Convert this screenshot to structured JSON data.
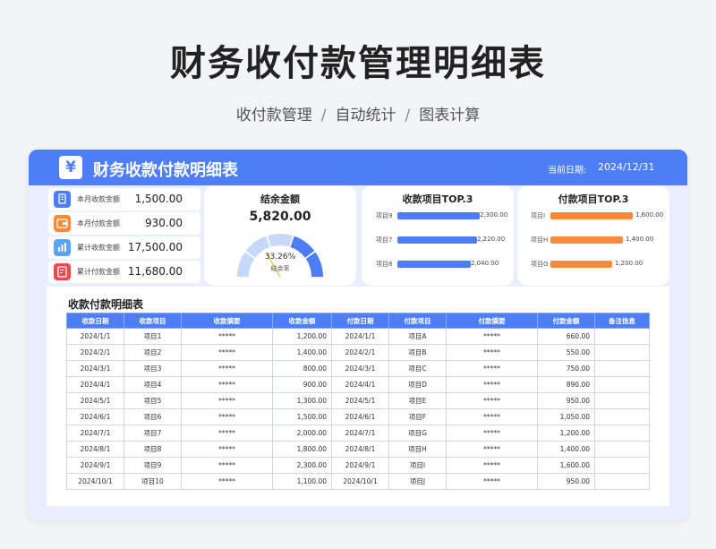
{
  "page": {
    "title": "财务收付款管理明细表",
    "subtitle_parts": [
      "收付款管理",
      "自动统计",
      "图表计算"
    ],
    "separator": "/"
  },
  "dashboard": {
    "title": "财务收款付款明细表",
    "yen_icon": "¥",
    "date_label": "当前日期:",
    "date_value": "2024/12/31",
    "colors": {
      "primary": "#4d7ef7",
      "orange": "#f88a3a",
      "red": "#ea4a4a",
      "light_blue": "#5ba3f5",
      "gauge_light": "#c6d9fb"
    }
  },
  "kpis": [
    {
      "label": "本月收款金额",
      "value": "1,500.00",
      "icon": "document-icon",
      "color": "#4d7ef7"
    },
    {
      "label": "本月付款金额",
      "value": "930.00",
      "icon": "wallet-icon",
      "color": "#f88a3a"
    },
    {
      "label": "累计收款金额",
      "value": "17,500.00",
      "icon": "bar-chart-icon",
      "color": "#5ba3f5"
    },
    {
      "label": "累计付款金额",
      "value": "11,680.00",
      "icon": "invoice-icon",
      "color": "#ea4a4a"
    }
  ],
  "balance": {
    "title": "结余金额",
    "value": "5,820.00",
    "rate": 0.3326,
    "rate_text": "33.26%",
    "rate_label": "结余率"
  },
  "income_top": {
    "title": "收款项目TOP.3",
    "items": [
      {
        "label": "项目9",
        "value": 2300,
        "value_text": "2,300.00"
      },
      {
        "label": "项目7",
        "value": 2220,
        "value_text": "2,220.00"
      },
      {
        "label": "项目8",
        "value": 2040,
        "value_text": "2,040.00"
      }
    ]
  },
  "expense_top": {
    "title": "付款项目TOP.3",
    "items": [
      {
        "label": "项目I",
        "value": 1600,
        "value_text": "1,600.00"
      },
      {
        "label": "项目H",
        "value": 1400,
        "value_text": "1,400.00"
      },
      {
        "label": "项目G",
        "value": 1200,
        "value_text": "1,200.00"
      }
    ]
  },
  "detail_table": {
    "title": "收款付款明细表",
    "headers": [
      "收款日期",
      "收款项目",
      "收款摘要",
      "收款金额",
      "付款日期",
      "付款项目",
      "付款摘要",
      "付款金额",
      "备注信息"
    ],
    "rows": [
      [
        "2024/1/1",
        "项目1",
        "*****",
        "1,200.00",
        "2024/1/1",
        "项目A",
        "*****",
        "660.00",
        ""
      ],
      [
        "2024/2/1",
        "项目2",
        "*****",
        "1,400.00",
        "2024/2/1",
        "项目B",
        "*****",
        "550.00",
        ""
      ],
      [
        "2024/3/1",
        "项目3",
        "*****",
        "800.00",
        "2024/3/1",
        "项目C",
        "*****",
        "750.00",
        ""
      ],
      [
        "2024/4/1",
        "项目4",
        "*****",
        "900.00",
        "2024/4/1",
        "项目D",
        "*****",
        "890.00",
        ""
      ],
      [
        "2024/5/1",
        "项目5",
        "*****",
        "1,300.00",
        "2024/5/1",
        "项目E",
        "*****",
        "950.00",
        ""
      ],
      [
        "2024/6/1",
        "项目6",
        "*****",
        "1,500.00",
        "2024/6/1",
        "项目F",
        "*****",
        "1,050.00",
        ""
      ],
      [
        "2024/7/1",
        "项目7",
        "*****",
        "2,000.00",
        "2024/7/1",
        "项目G",
        "*****",
        "1,200.00",
        ""
      ],
      [
        "2024/8/1",
        "项目8",
        "*****",
        "1,800.00",
        "2024/8/1",
        "项目H",
        "*****",
        "1,400.00",
        ""
      ],
      [
        "2024/9/1",
        "项目9",
        "*****",
        "2,300.00",
        "2024/9/1",
        "项目I",
        "*****",
        "1,600.00",
        ""
      ],
      [
        "2024/10/1",
        "项目10",
        "*****",
        "1,100.00",
        "2024/10/1",
        "项目J",
        "*****",
        "950.00",
        ""
      ]
    ]
  }
}
